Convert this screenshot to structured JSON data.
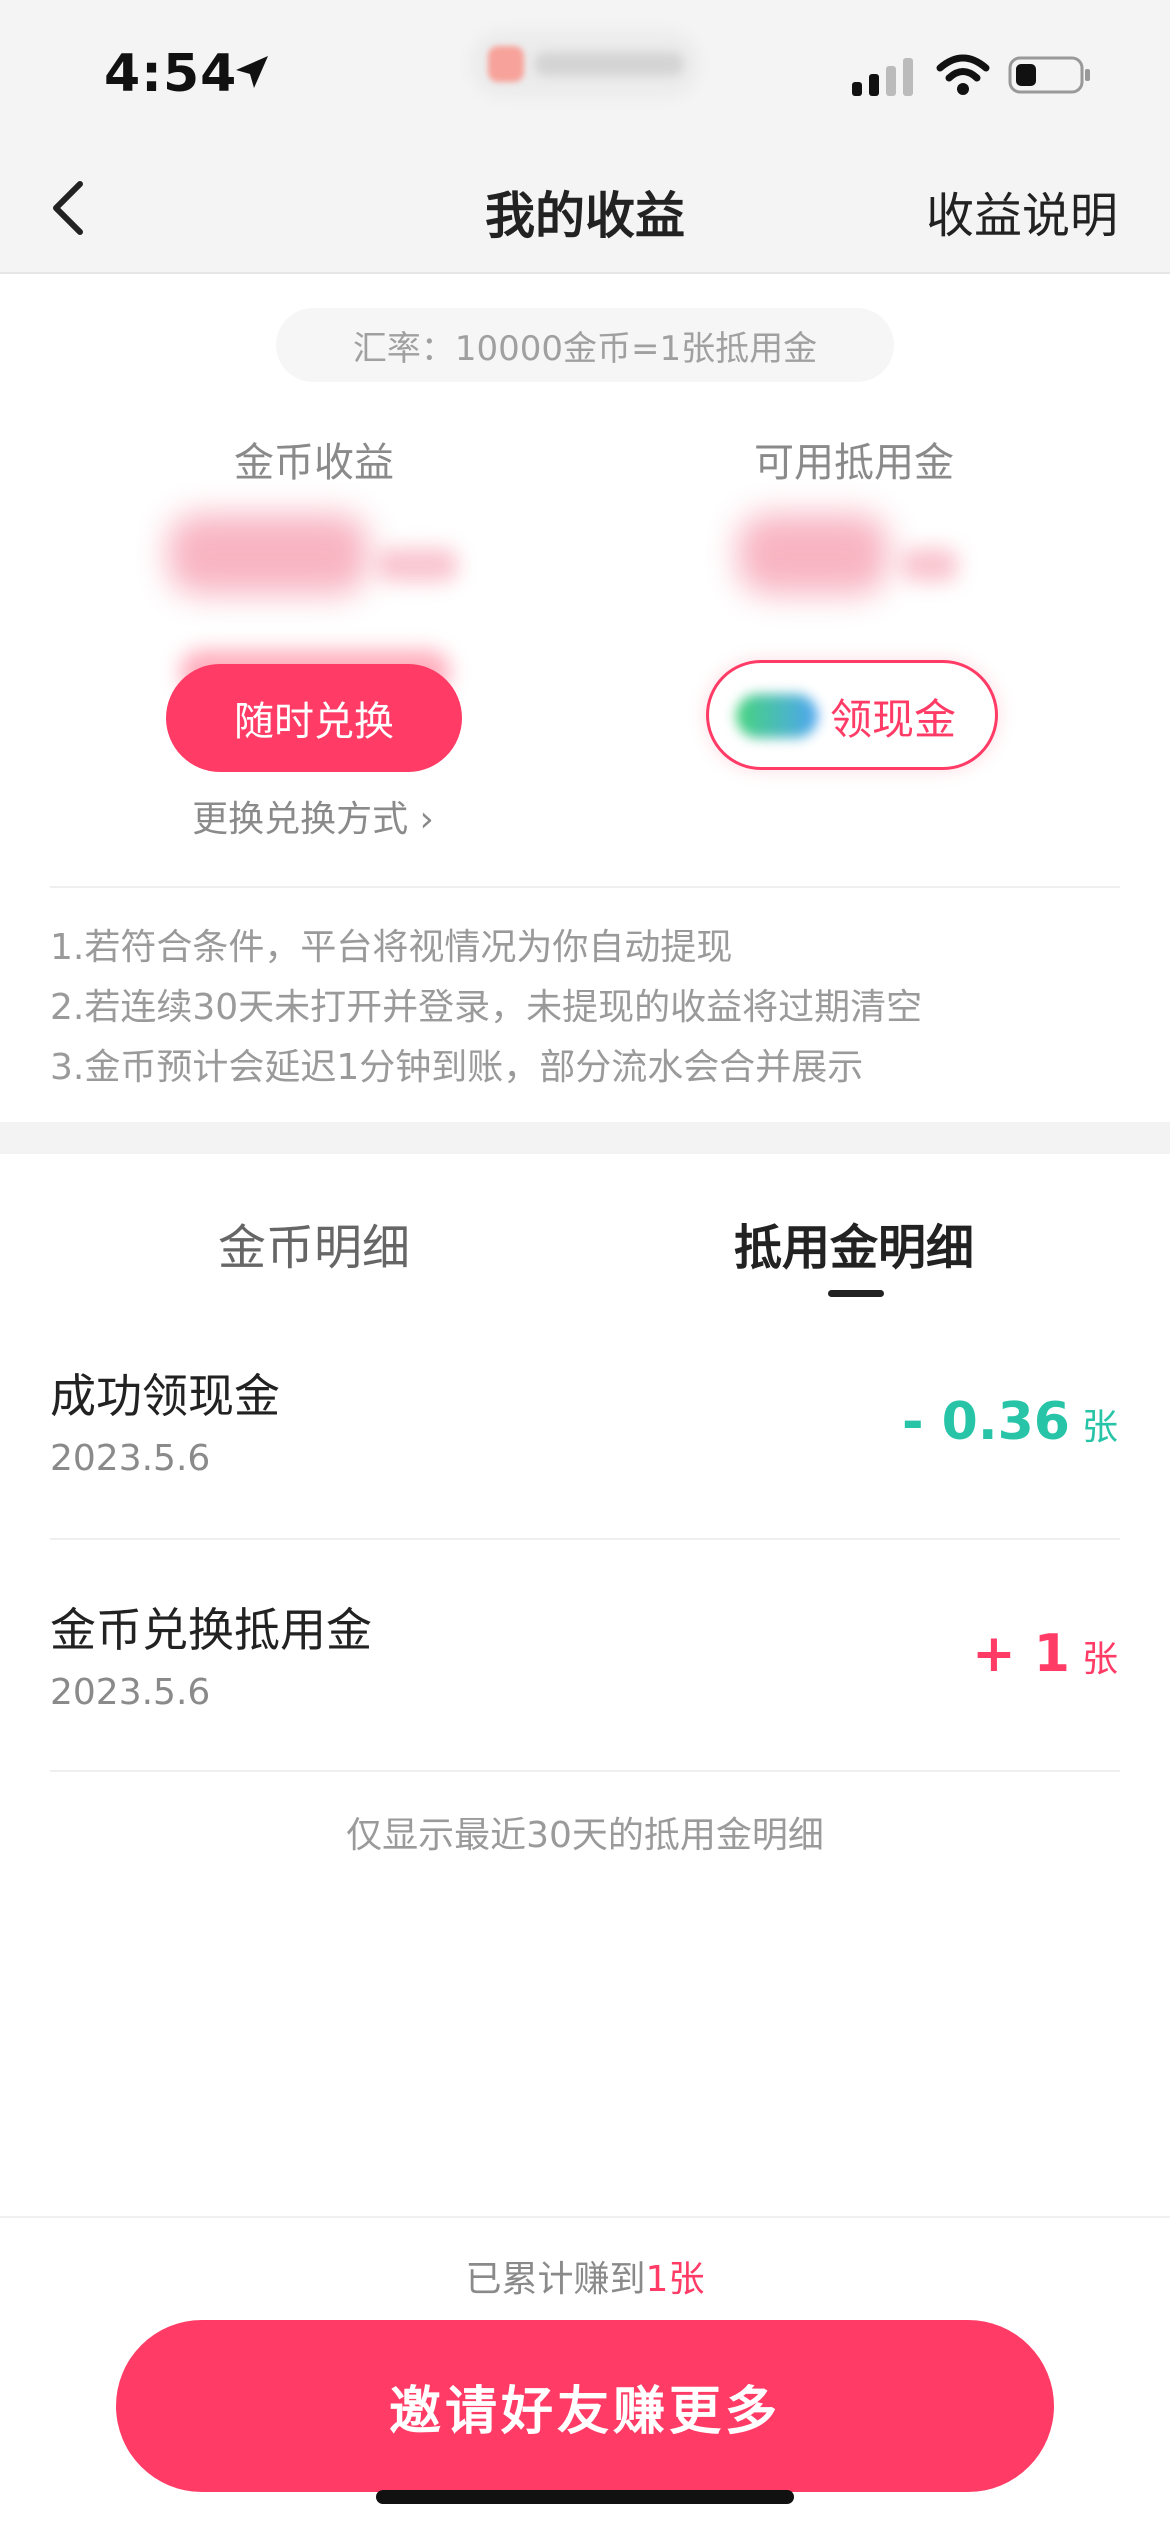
{
  "status_bar": {
    "time": "4:54"
  },
  "nav": {
    "title": "我的收益",
    "help_label": "收益说明"
  },
  "rate": {
    "text": "汇率：10000金币=1张抵用金"
  },
  "earnings": {
    "coin_label": "金币收益",
    "voucher_label": "可用抵用金",
    "exchange_label": "随时兑换",
    "change_method_label": "更换兑换方式 ›",
    "cash_label": "领现金"
  },
  "notes": [
    "1.若符合条件，平台将视情况为你自动提现",
    "2.若连续30天未打开并登录，未提现的收益将过期清空",
    "3.金币预计会延迟1分钟到账，部分流水会合并展示"
  ],
  "tabs": [
    {
      "label": "金币明细",
      "active": false
    },
    {
      "label": "抵用金明细",
      "active": true
    }
  ],
  "records": [
    {
      "title": "成功领现金",
      "date": "2023.5.6",
      "amount": "- 0.36",
      "unit": "张"
    },
    {
      "title": "金币兑换抵用金",
      "date": "2023.5.6",
      "amount": "+ 1",
      "unit": "张"
    }
  ],
  "footnote": "仅显示最近30天的抵用金明细",
  "total": {
    "prefix": "已累计赚到",
    "value": "1张"
  },
  "invite_label": "邀请好友赚更多",
  "colors": {
    "accent": "#ff3b66",
    "negative": "#27c4a8"
  }
}
